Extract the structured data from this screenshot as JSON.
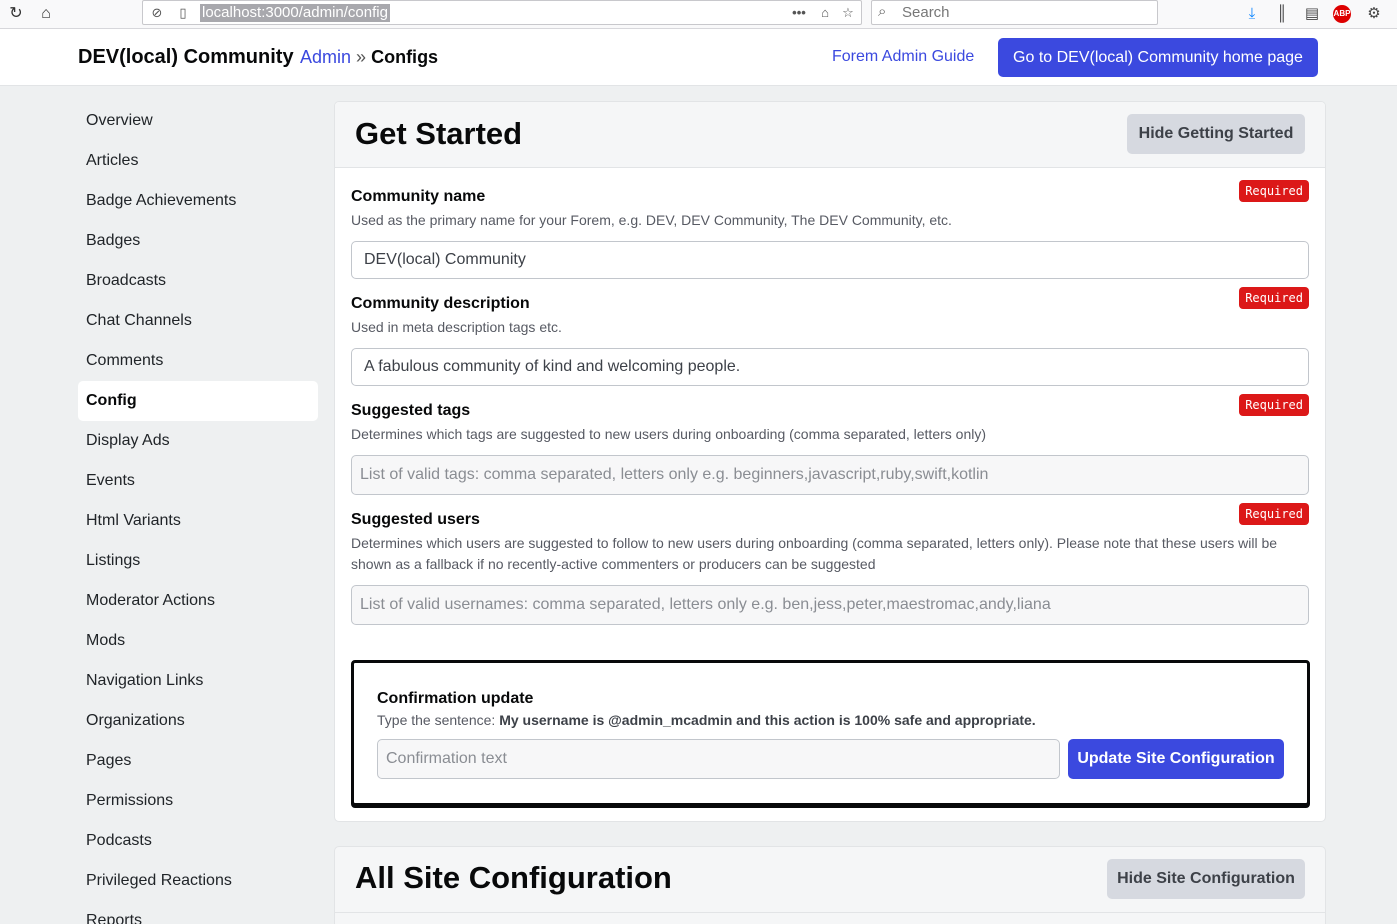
{
  "browser": {
    "url": "localhost:3000/admin/config",
    "search_placeholder": "Search",
    "icons": [
      "reload-icon",
      "home-icon",
      "tracking-protection-icon",
      "page-info-icon",
      "more-actions-icon",
      "pocket-icon",
      "bookmark-star-icon",
      "search-icon",
      "download-icon",
      "library-icon",
      "sidebar-icon",
      "adblock-icon",
      "extension-icon"
    ],
    "adblock_label": "ABP",
    "accent": "#3b49df"
  },
  "header": {
    "brand": "DEV(local) Community",
    "breadcrumb_admin": "Admin",
    "breadcrumb_sep": "»",
    "breadcrumb_current": "Configs",
    "guide_link": "Forem Admin Guide",
    "home_button": "Go to DEV(local) Community home page"
  },
  "sidebar": {
    "items": [
      {
        "label": "Overview"
      },
      {
        "label": "Articles"
      },
      {
        "label": "Badge Achievements"
      },
      {
        "label": "Badges"
      },
      {
        "label": "Broadcasts"
      },
      {
        "label": "Chat Channels"
      },
      {
        "label": "Comments"
      },
      {
        "label": "Config"
      },
      {
        "label": "Display Ads"
      },
      {
        "label": "Events"
      },
      {
        "label": "Html Variants"
      },
      {
        "label": "Listings"
      },
      {
        "label": "Moderator Actions"
      },
      {
        "label": "Mods"
      },
      {
        "label": "Navigation Links"
      },
      {
        "label": "Organizations"
      },
      {
        "label": "Pages"
      },
      {
        "label": "Permissions"
      },
      {
        "label": "Podcasts"
      },
      {
        "label": "Privileged Reactions"
      },
      {
        "label": "Reports"
      }
    ],
    "active": "Config"
  },
  "get_started": {
    "title": "Get Started",
    "hide_button": "Hide Getting Started",
    "required_label": "Required",
    "fields": [
      {
        "label": "Community name",
        "description": "Used as the primary name for your Forem, e.g. DEV, DEV Community, The DEV Community, etc.",
        "value": "DEV(local) Community",
        "placeholder": ""
      },
      {
        "label": "Community description",
        "description": "Used in meta description tags etc.",
        "value": "A fabulous community of kind and welcoming people.",
        "placeholder": ""
      },
      {
        "label": "Suggested tags",
        "description": "Determines which tags are suggested to new users during onboarding (comma separated, letters only)",
        "value": "",
        "placeholder": "List of valid tags: comma separated, letters only e.g. beginners,javascript,ruby,swift,kotlin"
      },
      {
        "label": "Suggested users",
        "description": "Determines which users are suggested to follow to new users during onboarding (comma separated, letters only). Please note that these users will be shown as a fallback if no recently-active commenters or producers can be suggested",
        "value": "",
        "placeholder": "List of valid usernames: comma separated, letters only e.g. ben,jess,peter,maestromac,andy,liana"
      }
    ],
    "confirmation": {
      "label": "Confirmation update",
      "prefix": "Type the sentence:",
      "sentence": "My username is @admin_mcadmin and this action is 100% safe and appropriate.",
      "placeholder": "Confirmation text",
      "submit": "Update Site Configuration"
    }
  },
  "all_site": {
    "title": "All Site Configuration",
    "hide_button": "Hide Site Configuration"
  }
}
